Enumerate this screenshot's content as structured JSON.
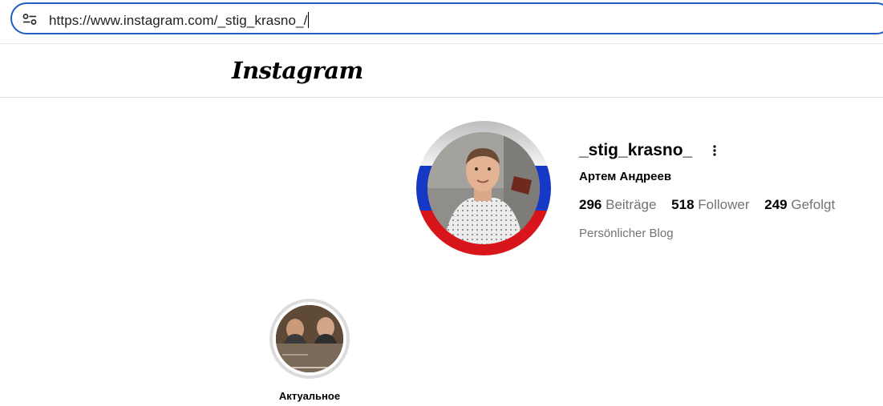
{
  "browser": {
    "url": "https://www.instagram.com/_stig_krasno_/",
    "site_info_icon": "tune-icon"
  },
  "header": {
    "logo_text": "Instagram"
  },
  "profile": {
    "username": "_stig_krasno_",
    "full_name": "Артем Андреев",
    "more_icon": "more-vertical-icon",
    "stats": [
      {
        "value": "296",
        "label": "Beiträge"
      },
      {
        "value": "518",
        "label": "Follower"
      },
      {
        "value": "249",
        "label": "Gefolgt"
      }
    ],
    "category": "Persönlicher Blog",
    "avatar_ring_colors": [
      "#ffffff",
      "#1638c7",
      "#d8151a"
    ]
  },
  "highlights": [
    {
      "label": "Актуальное"
    }
  ]
}
